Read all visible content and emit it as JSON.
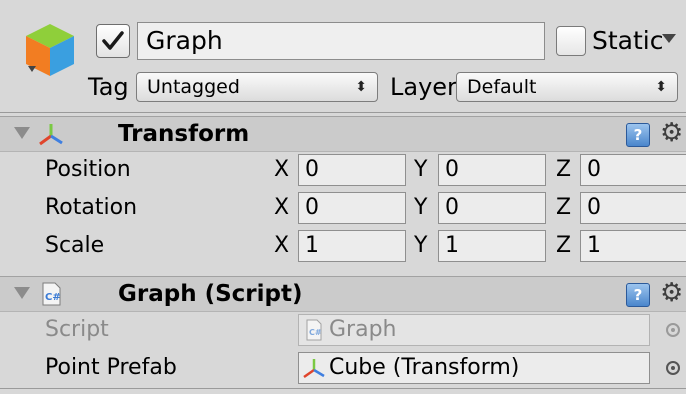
{
  "object": {
    "name": "Graph",
    "active": true,
    "static_label": "Static",
    "static_checked": false,
    "tag_label": "Tag",
    "tag_value": "Untagged",
    "layer_label": "Layer",
    "layer_value": "Default",
    "dropdown_arrows": "⬍"
  },
  "transform": {
    "title": "Transform",
    "help_glyph": "?",
    "gear_glyph": "⚙",
    "rows": [
      {
        "label": "Position",
        "x": "0",
        "y": "0",
        "z": "0"
      },
      {
        "label": "Rotation",
        "x": "0",
        "y": "0",
        "z": "0"
      },
      {
        "label": "Scale",
        "x": "1",
        "y": "1",
        "z": "1"
      }
    ],
    "axis_labels": {
      "x": "X",
      "y": "Y",
      "z": "Z"
    }
  },
  "script_component": {
    "title": "Graph (Script)",
    "help_glyph": "?",
    "gear_glyph": "⚙",
    "script_label": "Script",
    "script_value": "Graph",
    "prefab_label": "Point Prefab",
    "prefab_value": "Cube (Transform)"
  },
  "colors": {
    "panel": "#d8d8d8",
    "component_header": "#cbcbcb",
    "help_blue": "#4a86cc",
    "axis_x": "#e0452c",
    "axis_y": "#7ac943",
    "axis_z": "#3f7fe0",
    "cube_top": "#8fcf3a",
    "cube_left": "#f27d22",
    "cube_right": "#3a9fe0"
  },
  "icons": {
    "object": "cube-icon",
    "transform": "transform-axes-icon",
    "script": "csharp-script-icon",
    "help": "help-book-icon",
    "settings": "gear-icon",
    "picker": "object-picker-icon"
  }
}
